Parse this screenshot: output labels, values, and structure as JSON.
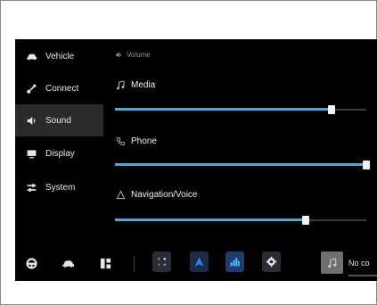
{
  "sidebar": {
    "items": [
      {
        "label": "Vehicle",
        "icon": "car-icon"
      },
      {
        "label": "Connect",
        "icon": "connect-icon"
      },
      {
        "label": "Sound",
        "icon": "speaker-icon",
        "active": true
      },
      {
        "label": "Display",
        "icon": "display-icon"
      },
      {
        "label": "System",
        "icon": "system-icon"
      }
    ]
  },
  "sound": {
    "section_title": "Volume",
    "channels": [
      {
        "label": "Media",
        "icon": "music-note-icon",
        "level": 0.86
      },
      {
        "label": "Phone",
        "icon": "phone-icon",
        "level": 1.0
      },
      {
        "label": "Navigation/Voice",
        "icon": "navigation-icon",
        "level": 0.76
      }
    ]
  },
  "dock": {
    "buttons": [
      "steering-wheel-icon",
      "car-icon",
      "apps-grid-icon"
    ],
    "apps": [
      "phone-app-icon",
      "navigation-app-icon",
      "equalizer-app-icon",
      "settings-gear-icon"
    ],
    "now_playing": {
      "text": "No co",
      "icon": "music-note-icon"
    }
  },
  "colors": {
    "accent": "#29b6e8",
    "background": "#000000"
  }
}
